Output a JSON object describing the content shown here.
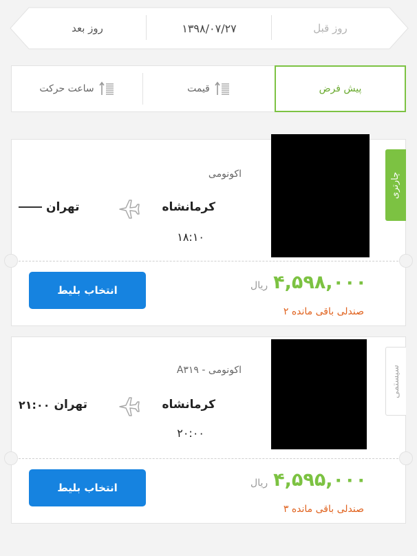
{
  "date_nav": {
    "next_label": "روز بعد",
    "current_date": "۱۳۹۸/۰۷/۲۷",
    "prev_label": "روز قبل"
  },
  "sort": {
    "default_label": "پیش فرض",
    "price_label": "قیمت",
    "time_label": "ساعت حرکت"
  },
  "flights": [
    {
      "type_tag": "چارتری",
      "class": "اکونومی",
      "origin": "کرمانشاه",
      "destination": "تهران",
      "departure_time": "۱۸:۱۰",
      "arrival_time": "",
      "price": "۴,۵۹۸,۰۰۰",
      "currency": "ریال",
      "seats_left": "۲ صندلی باقی مانده",
      "button_label": "انتخاب بلیط"
    },
    {
      "type_tag": "سیستمی",
      "class": "A۳۱۹ - اکونومی",
      "origin": "کرمانشاه",
      "destination": "تهران",
      "departure_time": "۲۰:۰۰",
      "arrival_time": "۲۱:۰۰",
      "price": "۴,۵۹۵,۰۰۰",
      "currency": "ریال",
      "seats_left": "۳ صندلی باقی مانده",
      "button_label": "انتخاب بلیط"
    }
  ],
  "colors": {
    "accent_green": "#7cc242",
    "button_blue": "#1683e0",
    "seats_orange": "#e0621e"
  },
  "icons": {
    "sort": "sort-arrow-lines-icon",
    "plane": "airplane-icon"
  }
}
